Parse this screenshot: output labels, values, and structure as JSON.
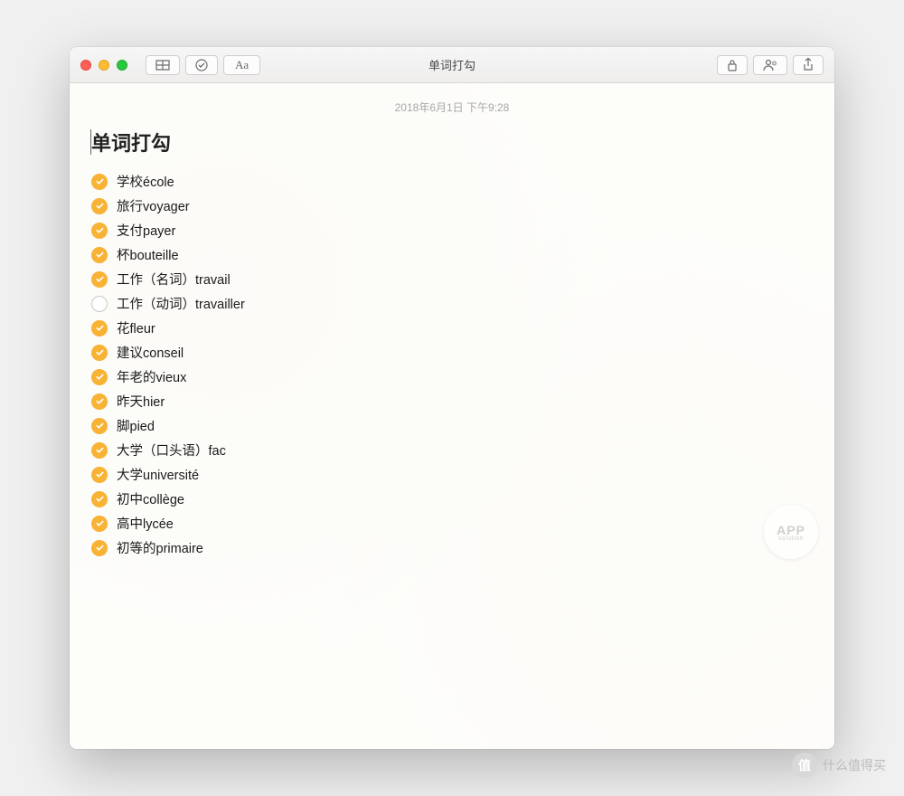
{
  "window": {
    "title": "单词打勾"
  },
  "toolbar": {
    "aa_label": "Aa"
  },
  "note": {
    "timestamp": "2018年6月1日 下午9:28",
    "title": "单词打勾"
  },
  "checklist": [
    {
      "text": "学校école",
      "checked": true
    },
    {
      "text": "旅行voyager",
      "checked": true
    },
    {
      "text": "支付payer",
      "checked": true
    },
    {
      "text": "杯bouteille",
      "checked": true
    },
    {
      "text": "工作（名词）travail",
      "checked": true
    },
    {
      "text": "工作（动词）travailler",
      "checked": false
    },
    {
      "text": "花fleur",
      "checked": true
    },
    {
      "text": "建议conseil",
      "checked": true
    },
    {
      "text": "年老的vieux",
      "checked": true
    },
    {
      "text": "昨天hier",
      "checked": true
    },
    {
      "text": "脚pied",
      "checked": true
    },
    {
      "text": "大学（口头语）fac",
      "checked": true
    },
    {
      "text": "大学université",
      "checked": true
    },
    {
      "text": "初中collège",
      "checked": true
    },
    {
      "text": "高中lycée",
      "checked": true
    },
    {
      "text": "初等的primaire",
      "checked": true
    }
  ],
  "watermark": {
    "main": "APP",
    "sub": "solution"
  },
  "bottom_watermark": {
    "badge": "值",
    "text": "什么值得买"
  }
}
